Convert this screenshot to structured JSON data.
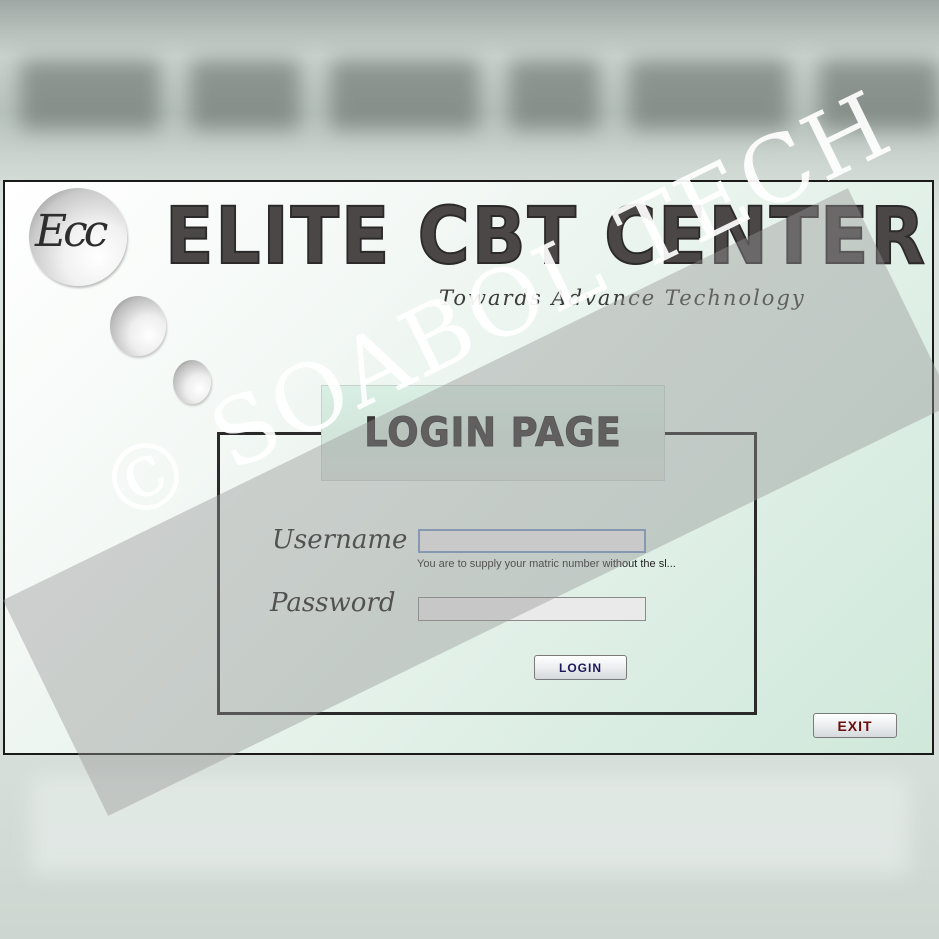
{
  "window": {
    "caption": "",
    "logo_text": "Ecc",
    "app_title": "ELITE CBT CENTER",
    "tagline": "Towards Advance Technology"
  },
  "login": {
    "title": "LOGIN PAGE",
    "username_label": "Username",
    "username_value": "",
    "username_hint": "You are to supply your matric number without the sl...",
    "password_label": "Password",
    "password_value": "",
    "login_button": "LOGIN",
    "exit_button": "EXIT"
  },
  "watermark": {
    "text": "© SOABOL TECH"
  },
  "colors": {
    "title": "#4b4747",
    "login_button_text": "#1a1a5a",
    "exit_button_text": "#6a0e0e",
    "window_bg_end": "#cfe8da"
  }
}
